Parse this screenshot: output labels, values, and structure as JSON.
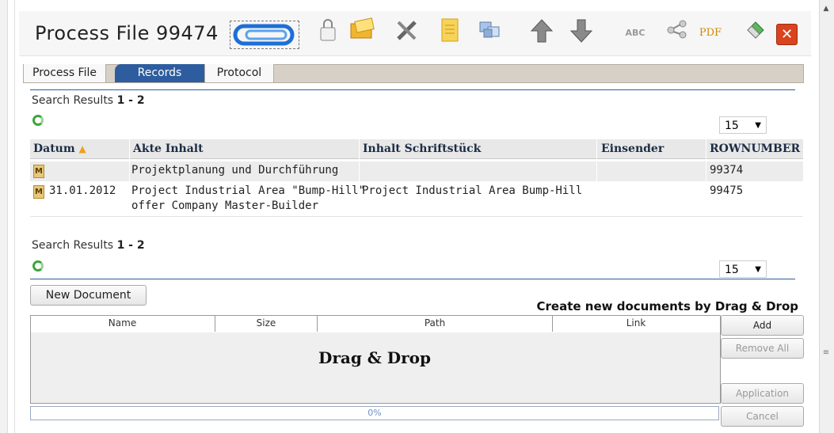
{
  "window": {
    "title": "Process File",
    "file_number": "99474"
  },
  "tabs": [
    {
      "label": "Process File"
    },
    {
      "label": "Records"
    },
    {
      "label": "Protocol"
    }
  ],
  "toolbar_icons": [
    "paperclip-icon",
    "lock-icon",
    "folder-icon",
    "tools-icon",
    "document-icon",
    "boxes-icon",
    "arrow-up-icon",
    "arrow-down-icon",
    "spellcheck-icon",
    "share-icon",
    "pdf-icon",
    "eraser-icon",
    "close-icon"
  ],
  "pdf_label": "PDF",
  "spell_label": "ABC",
  "search_top": {
    "label": "Search Results",
    "range": "1 - 2",
    "page_size": "15"
  },
  "table": {
    "headers": [
      "Datum",
      "Akte Inhalt",
      "Inhalt Schriftstück",
      "Einsender",
      "ROWNUMBER"
    ],
    "rows": [
      {
        "icon": "M",
        "datum": "",
        "akte_line1": "Projektplanung und Durchführung",
        "akte_line2": "",
        "inhalt": "",
        "einsender": "",
        "rownumber": "99374"
      },
      {
        "icon": "M",
        "datum": "31.01.2012",
        "akte_line1": "Project Industrial Area \"Bump-Hill\"",
        "akte_line2": "offer Company Master-Builder",
        "inhalt": "Project Industrial Area Bump-Hill",
        "einsender": "",
        "rownumber": "99475"
      }
    ]
  },
  "search_bottom": {
    "label": "Search Results",
    "range": "1 - 2",
    "page_size": "15"
  },
  "new_document_label": "New Document",
  "dnd_hint": "Create new documents by Drag & Drop",
  "upload_columns": [
    "Name",
    "Size",
    "Path",
    "Link"
  ],
  "dnd_area_text": "Drag & Drop",
  "side_buttons": {
    "add": "Add",
    "remove_all": "Remove All",
    "application": "Application",
    "cancel": "Cancel"
  },
  "progress": {
    "value": 0,
    "text": "0%"
  },
  "colors": {
    "accent": "#2d5d9e",
    "tab_bar": "#d7d0c6",
    "progress_text": "#6a8fc8"
  }
}
